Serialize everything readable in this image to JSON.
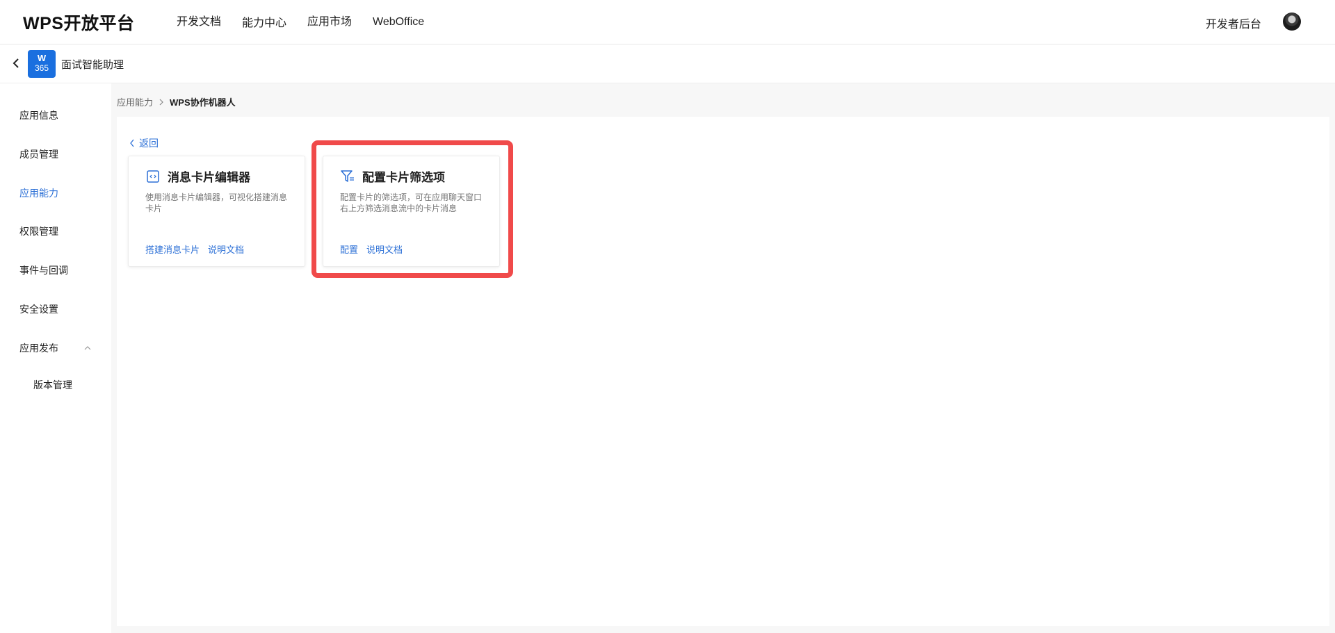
{
  "header": {
    "logo": "WPS开放平台",
    "nav": [
      "开发文档",
      "能力中心",
      "应用市场",
      "WebOffice"
    ],
    "dev_console": "开发者后台"
  },
  "app": {
    "icon_line1": "W",
    "icon_line2": "365",
    "name": "面试智能助理"
  },
  "sidebar": {
    "items": [
      "应用信息",
      "成员管理",
      "应用能力",
      "权限管理",
      "事件与回调",
      "安全设置",
      "应用发布"
    ],
    "sub_items": [
      "版本管理"
    ],
    "active": "应用能力"
  },
  "breadcrumb": {
    "parent": "应用能力",
    "current": "WPS协作机器人"
  },
  "main": {
    "back_label": "返回",
    "cards": [
      {
        "icon": "code-box-icon",
        "title": "消息卡片编辑器",
        "desc": "使用消息卡片编辑器，可视化搭建消息卡片",
        "links": [
          "搭建消息卡片",
          "说明文档"
        ]
      },
      {
        "icon": "filter-icon",
        "title": "配置卡片筛选项",
        "desc": "配置卡片的筛选项，可在应用聊天窗口右上方筛选消息流中的卡片消息",
        "links": [
          "配置",
          "说明文档"
        ]
      }
    ]
  },
  "colors": {
    "accent": "#2b6fd6",
    "highlight": "#f04a4a",
    "app_icon": "#1a6fdf"
  }
}
